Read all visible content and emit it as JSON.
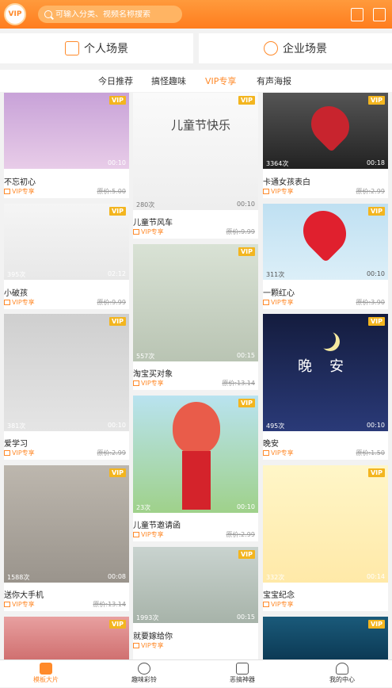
{
  "header": {
    "logo_text": "VIP",
    "search_placeholder": "可输入分类、视频名称搜索"
  },
  "scenes": [
    {
      "label": "个人场景"
    },
    {
      "label": "企业场景"
    }
  ],
  "tabs": [
    {
      "label": "今日推荐"
    },
    {
      "label": "搞怪趣味"
    },
    {
      "label": "VIP专享"
    },
    {
      "label": "有声海报"
    }
  ],
  "vip_badge": "VIP",
  "tag_label": "VIP专享",
  "cards": [
    {
      "title": "不忘初心",
      "views": "",
      "duration": "00:10",
      "old_price": "原价:5.00"
    },
    {
      "title": "儿童节快乐",
      "views": "280次",
      "duration": "00:10",
      "old_price": ""
    },
    {
      "title": "卡通女孩表白",
      "views": "3364次",
      "duration": "00:18",
      "old_price": "原价:2.99"
    },
    {
      "title": "儿童节风车",
      "views": "",
      "duration": "",
      "old_price": "原价:9.99"
    },
    {
      "title": "小破孩",
      "views": "395次",
      "duration": "02:12",
      "old_price": "原价:9.99"
    },
    {
      "title": "一颗红心",
      "views": "311次",
      "duration": "00:10",
      "old_price": "原价:3.90"
    },
    {
      "title": "淘宝买对象",
      "views": "557次",
      "duration": "00:15",
      "old_price": "原价:13.14"
    },
    {
      "title": "爱学习",
      "views": "381次",
      "duration": "00:10",
      "old_price": "原价:2.99"
    },
    {
      "title": "晚安",
      "views": "495次",
      "duration": "00:10",
      "old_price": "原价:1.50"
    },
    {
      "title": "儿童节邀请函",
      "views": "23次",
      "duration": "00:10",
      "old_price": "原价:2.99"
    },
    {
      "title": "送你大手机",
      "views": "1588次",
      "duration": "00:08",
      "old_price": "原价:13.14"
    },
    {
      "title": "宝宝纪念",
      "views": "332次",
      "duration": "00:14",
      "old_price": ""
    },
    {
      "title": "就要嫁给你",
      "views": "1993次",
      "duration": "00:15",
      "old_price": ""
    }
  ],
  "bottom_nav": [
    {
      "label": "模板大片"
    },
    {
      "label": "趣味彩铃"
    },
    {
      "label": "恶搞神器"
    },
    {
      "label": "我的中心"
    }
  ]
}
